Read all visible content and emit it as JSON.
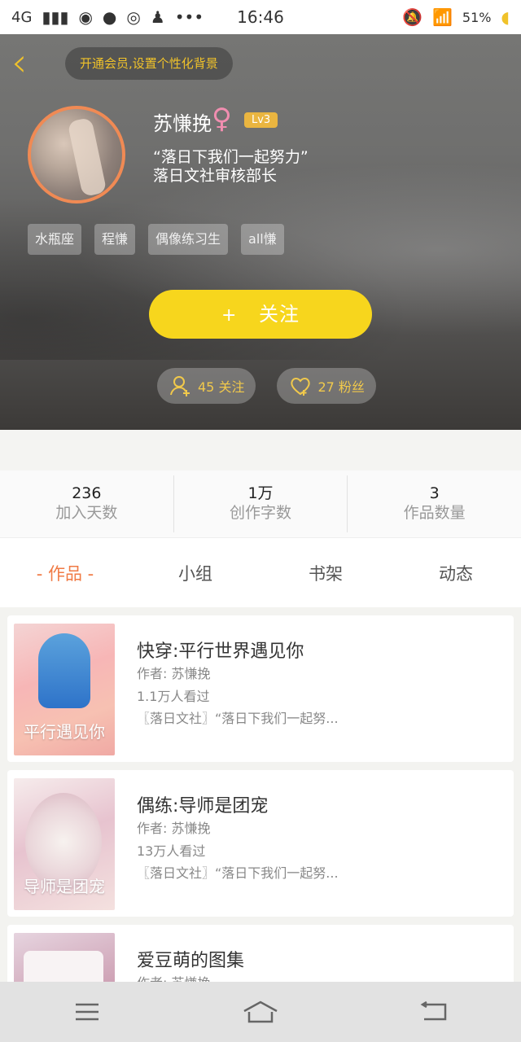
{
  "status_bar": {
    "network": "4G",
    "time": "16:46",
    "battery": "51%"
  },
  "header": {
    "vip_tip": "开通会员,设置个性化背景",
    "name": "苏慊挽",
    "gender_symbol": "♀",
    "level": "Lv3",
    "motto_line1": "“落日下我们一起努力”",
    "motto_line2": "落日文社审核部长",
    "tags": [
      "水瓶座",
      "程慊",
      "偶像练习生",
      "all慊"
    ],
    "follow_label": "关注",
    "follow_plus": "+",
    "following": "45 关注",
    "fans": "27 粉丝"
  },
  "stats": [
    {
      "value": "236",
      "label": "加入天数"
    },
    {
      "value": "1万",
      "label": "创作字数"
    },
    {
      "value": "3",
      "label": "作品数量"
    }
  ],
  "tabs": [
    {
      "label": "- 作品 -"
    },
    {
      "label": "小组"
    },
    {
      "label": "书架"
    },
    {
      "label": "动态"
    }
  ],
  "works": [
    {
      "title": "快穿:平行世界遇见你",
      "author": "作者: 苏慊挽",
      "views": "1.1万人看过",
      "desc": "〖落日文社〗“落日下我们一起努...",
      "cover_text": "平行遇见你"
    },
    {
      "title": "偶练:导师是团宠",
      "author": "作者: 苏慊挽",
      "views": "13万人看过",
      "desc": "〖落日文社〗“落日下我们一起努...",
      "cover_text": "导师是团宠"
    },
    {
      "title": "爱豆萌的图集",
      "author": "作者: 苏慊挽",
      "views": "",
      "desc": "",
      "cover_text": ""
    }
  ],
  "colors": {
    "accent": "#f7d61d",
    "orange": "#f07a44",
    "gold": "#f0c22a"
  }
}
